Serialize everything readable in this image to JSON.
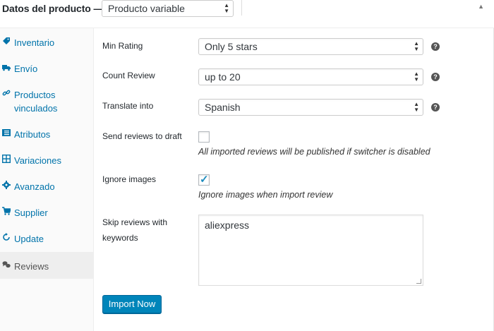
{
  "header": {
    "title": "Datos del producto —",
    "product_type": "Producto variable"
  },
  "sidebar": {
    "items": [
      {
        "label": "Inventario",
        "icon": "tag-icon"
      },
      {
        "label": "Envío",
        "icon": "truck-icon"
      },
      {
        "label": "Productos vinculados",
        "icon": "link-icon"
      },
      {
        "label": "Atributos",
        "icon": "list-icon"
      },
      {
        "label": "Variaciones",
        "icon": "grid-icon"
      },
      {
        "label": "Avanzado",
        "icon": "gear-icon"
      },
      {
        "label": "Supplier",
        "icon": "cart-icon"
      },
      {
        "label": "Update",
        "icon": "refresh-icon"
      },
      {
        "label": "Reviews",
        "icon": "comments-icon"
      }
    ],
    "active": "Reviews"
  },
  "form": {
    "min_rating": {
      "label": "Min Rating",
      "value": "Only 5 stars"
    },
    "count_review": {
      "label": "Count Review",
      "value": "up to 20"
    },
    "translate": {
      "label": "Translate into",
      "value": "Spanish"
    },
    "draft": {
      "label": "Send reviews to draft",
      "checked": false,
      "description": "All imported reviews will be published if switcher is disabled"
    },
    "ignore_images": {
      "label": "Ignore images",
      "checked": true,
      "description": "Ignore images when import review"
    },
    "skip_keywords": {
      "label_line1": "Skip reviews with",
      "label_line2": "keywords",
      "value": "aliexpress"
    },
    "import_button": "Import Now"
  },
  "colors": {
    "link": "#0073aa",
    "primary_button": "#0085ba",
    "check": "#1e8cbe"
  }
}
